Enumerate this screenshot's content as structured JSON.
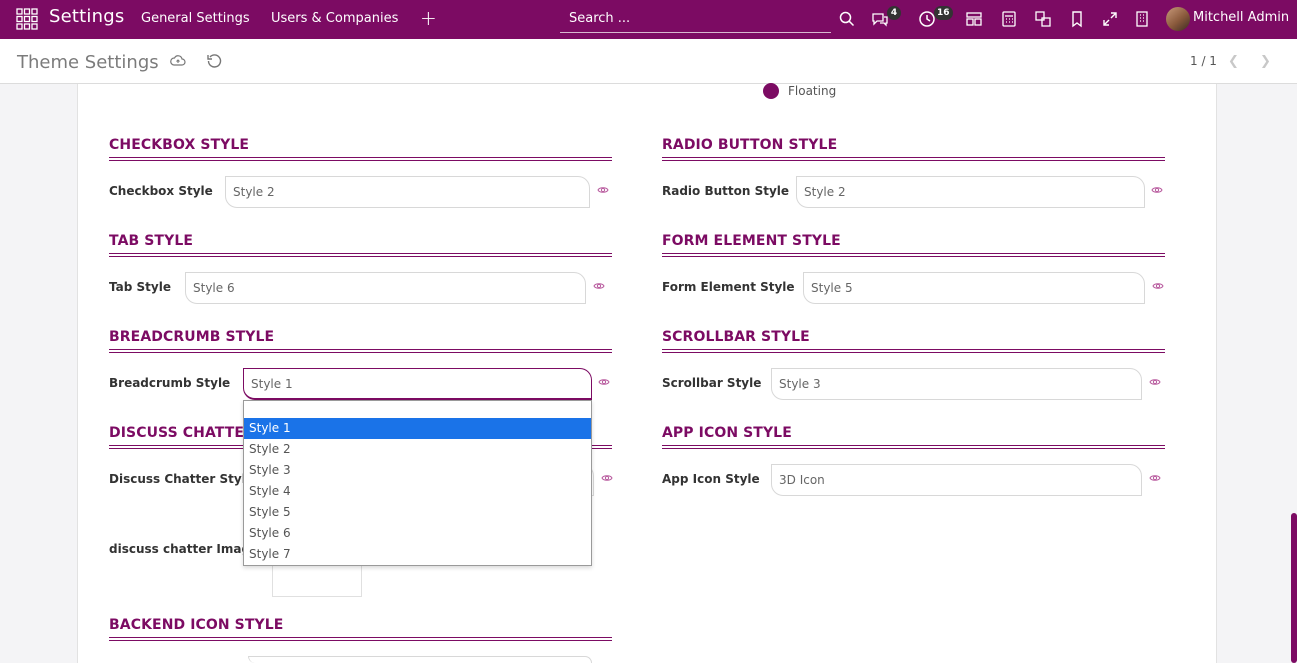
{
  "navbar": {
    "app_name": "Settings",
    "menu": [
      "General Settings",
      "Users & Companies"
    ],
    "search_placeholder": "Search ...",
    "messages_count": "4",
    "activities_count": "16",
    "user_name": "Mitchell Admin",
    "icons": [
      "apps-grid-icon",
      "plus-icon",
      "search-icon",
      "chat-icon",
      "clock-icon",
      "layout-icon",
      "calculator-icon",
      "language-icon",
      "bookmark-icon",
      "fullscreen-icon",
      "building-icon"
    ]
  },
  "control_panel": {
    "title": "Theme Settings",
    "pager": "1 / 1"
  },
  "floating_option": "Floating",
  "sections": {
    "checkbox": {
      "title": "CHECKBOX STYLE",
      "label": "Checkbox Style",
      "value": "Style 2"
    },
    "radio": {
      "title": "RADIO BUTTON STYLE",
      "label": "Radio Button Style",
      "value": "Style 2"
    },
    "tab": {
      "title": "TAB STYLE",
      "label": "Tab Style",
      "value": "Style 6"
    },
    "form_element": {
      "title": "FORM ELEMENT STYLE",
      "label": "Form Element Style",
      "value": "Style 5"
    },
    "breadcrumb": {
      "title": "BREADCRUMB STYLE",
      "label": "Breadcrumb Style",
      "value": "Style 1"
    },
    "scrollbar": {
      "title": "SCROLLBAR STYLE",
      "label": "Scrollbar Style",
      "value": "Style 3"
    },
    "discuss": {
      "title": "DISCUSS CHATTER",
      "label": "Discuss Chatter Style",
      "image_label": "discuss chatter Imag"
    },
    "app_icon": {
      "title": "APP ICON STYLE",
      "label": "App Icon Style",
      "value": "3D Icon"
    },
    "backend_icon": {
      "title": "BACKEND ICON STYLE"
    }
  },
  "dropdown": {
    "options": [
      "Style 1",
      "Style 2",
      "Style 3",
      "Style 4",
      "Style 5",
      "Style 6",
      "Style 7"
    ],
    "selected": "Style 1"
  },
  "colors": {
    "primary": "#7c0b63",
    "selection": "#1a73e8"
  }
}
